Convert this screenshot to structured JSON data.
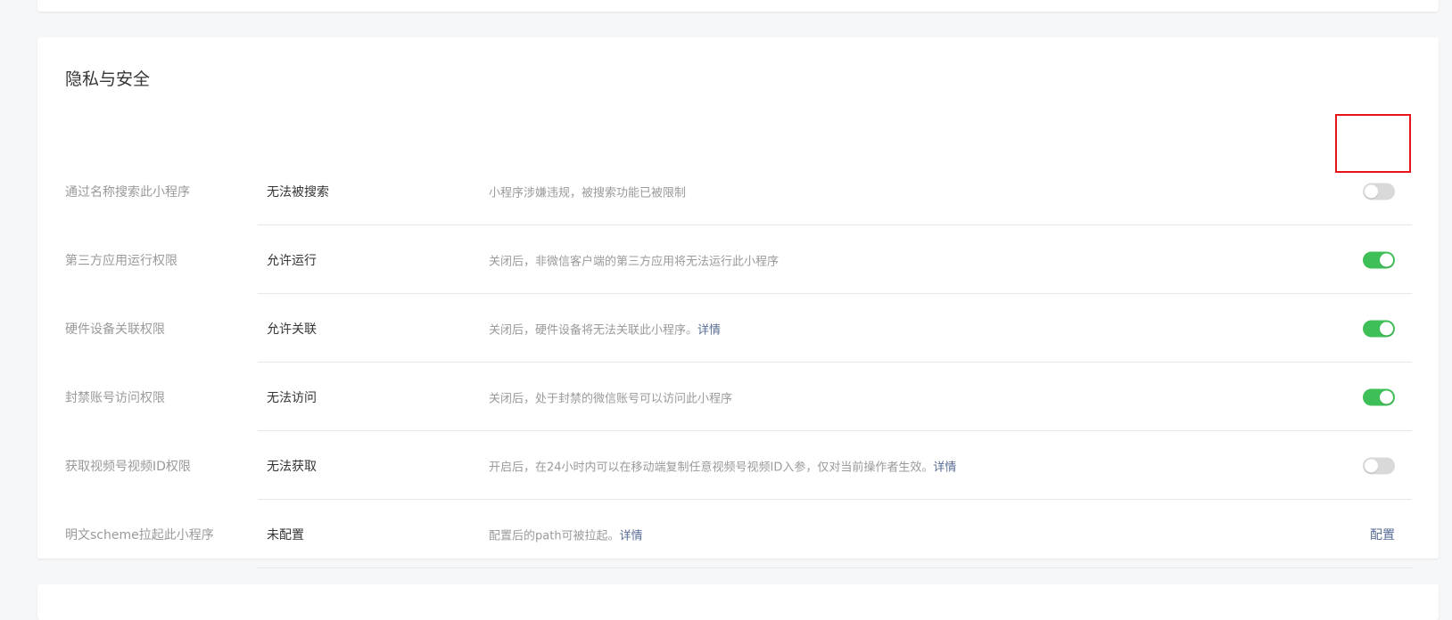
{
  "section": {
    "title": "隐私与安全"
  },
  "rows": [
    {
      "label": "通过名称搜索此小程序",
      "status": "无法被搜索",
      "desc": "小程序涉嫌违规，被搜索功能已被限制",
      "link": "",
      "control": "toggle",
      "enabled": false
    },
    {
      "label": "第三方应用运行权限",
      "status": "允许运行",
      "desc": "关闭后，非微信客户端的第三方应用将无法运行此小程序",
      "link": "",
      "control": "toggle",
      "enabled": true
    },
    {
      "label": "硬件设备关联权限",
      "status": "允许关联",
      "desc": "关闭后，硬件设备将无法关联此小程序。",
      "link": "详情",
      "control": "toggle",
      "enabled": true
    },
    {
      "label": "封禁账号访问权限",
      "status": "无法访问",
      "desc": "关闭后，处于封禁的微信账号可以访问此小程序",
      "link": "",
      "control": "toggle",
      "enabled": true
    },
    {
      "label": "获取视频号视频ID权限",
      "status": "无法获取",
      "desc": "开启后，在24小时内可以在移动端复制任意视频号视频ID入参，仅对当前操作者生效。",
      "link": "详情",
      "control": "toggle",
      "enabled": false
    },
    {
      "label": "明文scheme拉起此小程序",
      "status": "未配置",
      "desc": "配置后的path可被拉起。",
      "link": "详情",
      "control": "link",
      "action_label": "配置"
    }
  ],
  "colors": {
    "toggle_on": "#3fbf58",
    "toggle_off": "#d9d9d9",
    "link": "#576b95",
    "highlight": "#e8141a"
  }
}
